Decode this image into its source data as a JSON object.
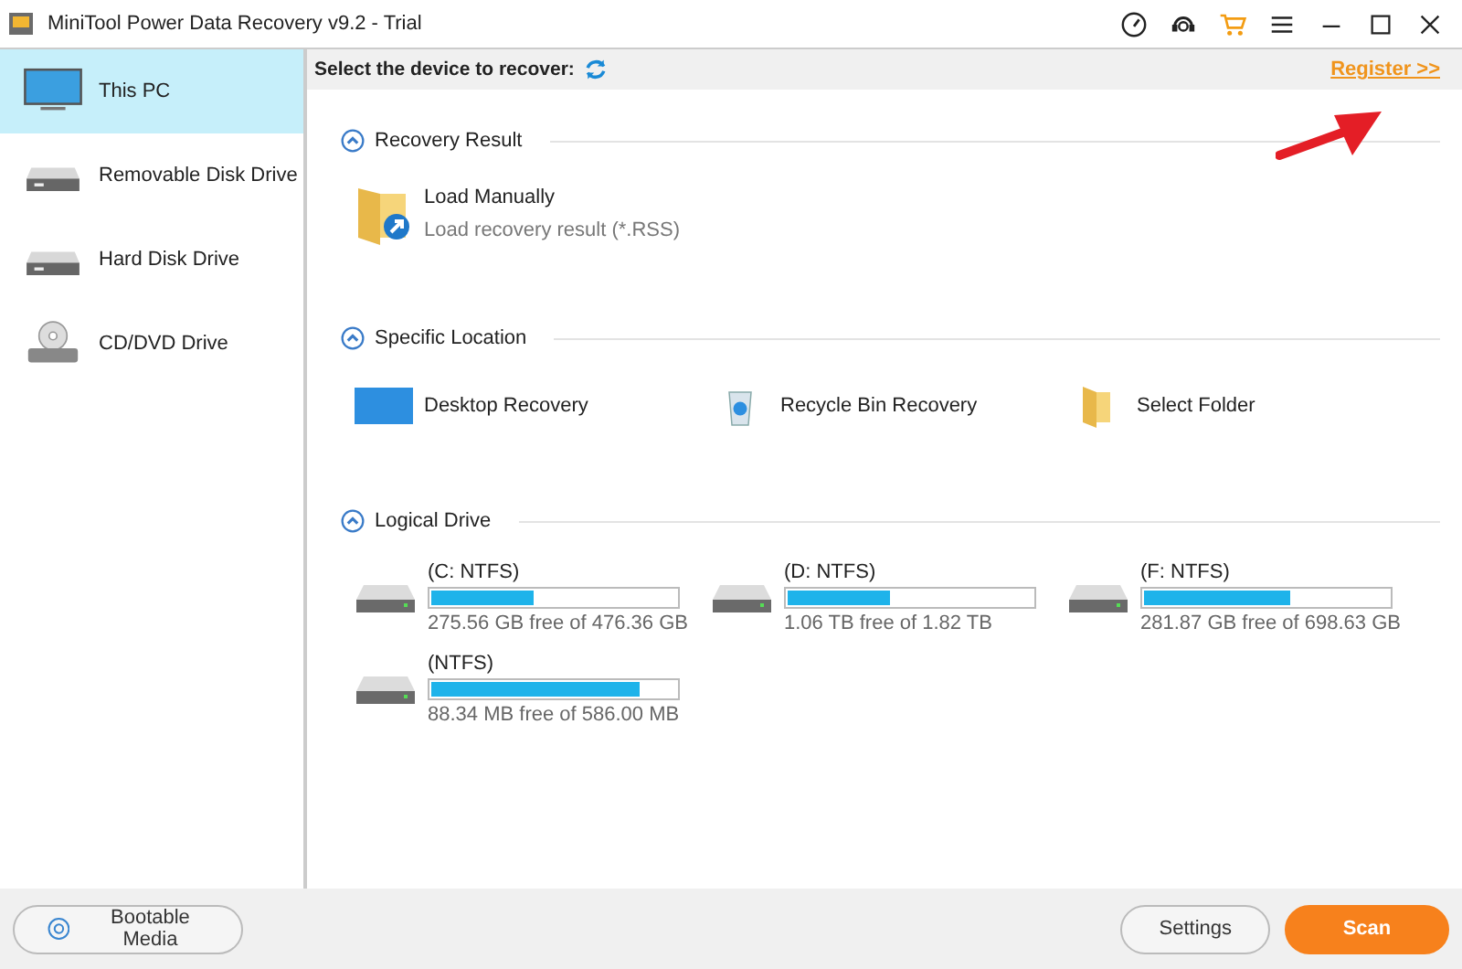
{
  "window": {
    "title": "MiniTool Power Data Recovery v9.2 - Trial"
  },
  "sidebar": {
    "items": [
      {
        "label": "This PC",
        "kind": "pc",
        "selected": true
      },
      {
        "label": "Removable Disk Drive",
        "kind": "removable",
        "selected": false
      },
      {
        "label": "Hard Disk Drive",
        "kind": "hdd",
        "selected": false
      },
      {
        "label": "CD/DVD Drive",
        "kind": "cd",
        "selected": false
      }
    ]
  },
  "toolbar": {
    "label": "Select the device to recover:",
    "register_link": "Register >>"
  },
  "sections": [
    {
      "title": "Recovery Result",
      "expanded": true,
      "kind": "load",
      "items": [
        {
          "label": "Load Manually",
          "sublabel": "Load recovery result (*.RSS)",
          "kind": "folder-arrow"
        }
      ]
    },
    {
      "title": "Specific Location",
      "expanded": true,
      "kind": "locations",
      "items": [
        {
          "label": "Desktop Recovery",
          "kind": "desktop"
        },
        {
          "label": "Recycle Bin Recovery",
          "kind": "recycle"
        },
        {
          "label": "Select Folder",
          "kind": "folder"
        }
      ]
    },
    {
      "title": "Logical Drive",
      "expanded": true,
      "kind": "drives",
      "items": [
        {
          "label": "(C: NTFS)",
          "level": 0.42,
          "capacity": "275.56 GB free of 476.36 GB"
        },
        {
          "label": "(D: NTFS)",
          "level": 0.42,
          "capacity": "1.06 TB free of 1.82 TB"
        },
        {
          "label": "(F: NTFS)",
          "level": 0.6,
          "capacity": "281.87 GB free of 698.63 GB"
        },
        {
          "label": "(NTFS)",
          "level": 0.85,
          "capacity": "88.34 MB free of 586.00 MB"
        }
      ]
    }
  ],
  "footer": {
    "bootable": "Bootable Media",
    "settings": "Settings",
    "scan": "Scan"
  }
}
